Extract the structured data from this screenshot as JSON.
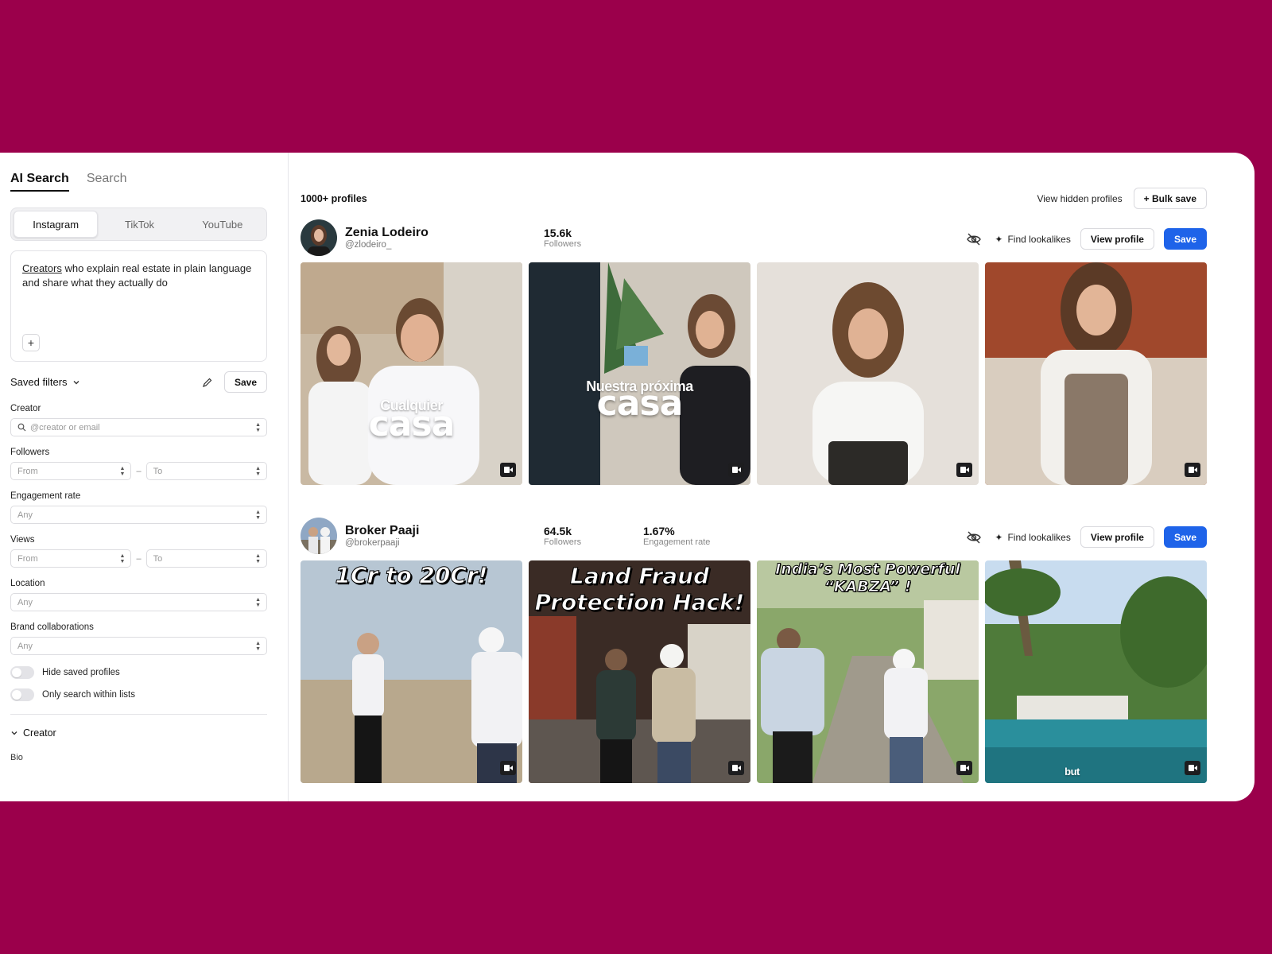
{
  "sidebar": {
    "mode_tabs": [
      {
        "label": "AI Search",
        "active": true
      },
      {
        "label": "Search",
        "active": false
      }
    ],
    "platforms": [
      {
        "label": "Instagram",
        "active": true
      },
      {
        "label": "TikTok",
        "active": false
      },
      {
        "label": "YouTube",
        "active": false
      }
    ],
    "prompt": {
      "highlight": "Creators",
      "text": " who explain real estate in plain language and share what they actually do"
    },
    "saved_filters": {
      "label": "Saved filters",
      "save_label": "Save"
    },
    "filters": {
      "creator": {
        "label": "Creator",
        "placeholder": "@creator or email"
      },
      "followers": {
        "label": "Followers",
        "from": "From",
        "to": "To"
      },
      "engagement": {
        "label": "Engagement rate",
        "value": "Any"
      },
      "views": {
        "label": "Views",
        "from": "From",
        "to": "To"
      },
      "location": {
        "label": "Location",
        "value": "Any"
      },
      "brand": {
        "label": "Brand collaborations",
        "value": "Any"
      }
    },
    "toggles": {
      "hide_saved": {
        "label": "Hide saved profiles",
        "on": false
      },
      "within_lists": {
        "label": "Only search within lists",
        "on": false
      }
    },
    "section": {
      "label": "Creator",
      "bio_label": "Bio"
    }
  },
  "main": {
    "count": "1000+ profiles",
    "view_hidden": "View hidden profiles",
    "bulk_save": "+ Bulk save",
    "action_labels": {
      "lookalikes": "Find lookalikes",
      "view_profile": "View profile",
      "save": "Save"
    },
    "profiles": [
      {
        "name": "Zenia Lodeiro",
        "handle": "@zlodeiro_",
        "stats": [
          {
            "value": "15.6k",
            "label": "Followers"
          }
        ],
        "thumbs": [
          {
            "small": "Cualquier",
            "big": "casa"
          },
          {
            "small": "Nuestra próxima",
            "big": "casa"
          },
          {},
          {}
        ]
      },
      {
        "name": "Broker Paaji",
        "handle": "@brokerpaaji",
        "stats": [
          {
            "value": "64.5k",
            "label": "Followers"
          },
          {
            "value": "1.67%",
            "label": "Engagement rate"
          }
        ],
        "thumbs": [
          {
            "title": "1Cr to 20Cr!"
          },
          {
            "line1": "Land Fraud",
            "line2": "Protection Hack!"
          },
          {
            "line1": "India’s Most Powerful",
            "line2": "“KABZA” !"
          },
          {
            "caption": "but"
          }
        ]
      }
    ]
  },
  "colors": {
    "page_bg": "#9b004b",
    "accent": "#1e63e9"
  }
}
